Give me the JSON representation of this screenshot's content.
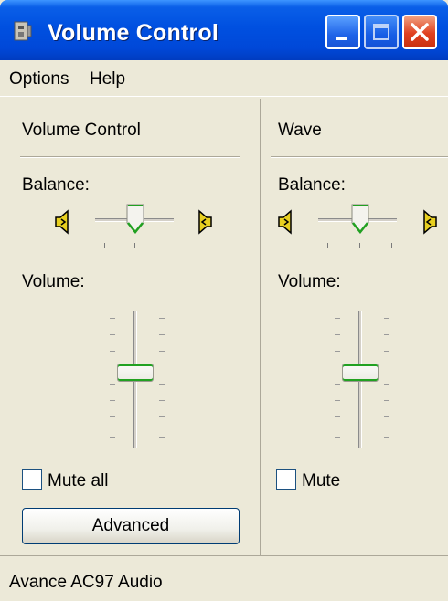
{
  "window": {
    "title": "Volume Control",
    "icon": "speaker-app-icon",
    "controls": [
      "minimize",
      "maximize",
      "close"
    ]
  },
  "menu": {
    "items": [
      {
        "label": "Options"
      },
      {
        "label": "Help"
      }
    ]
  },
  "channels": [
    {
      "title": "Volume Control",
      "balance_label": "Balance:",
      "volume_label": "Volume:",
      "balance": 0.5,
      "volume": 0.5,
      "mute_label": "Mute all",
      "muted": false,
      "button_label": "Advanced"
    },
    {
      "title": "Wave",
      "balance_label": "Balance:",
      "volume_label": "Volume:",
      "balance": 0.5,
      "volume": 0.5,
      "mute_label": "Mute",
      "muted": false
    }
  ],
  "status": {
    "text": "Avance AC97 Audio"
  },
  "colors": {
    "titlebar": "#0050e0",
    "thumb_accent": "#21a121",
    "speaker": "#e8d020"
  }
}
